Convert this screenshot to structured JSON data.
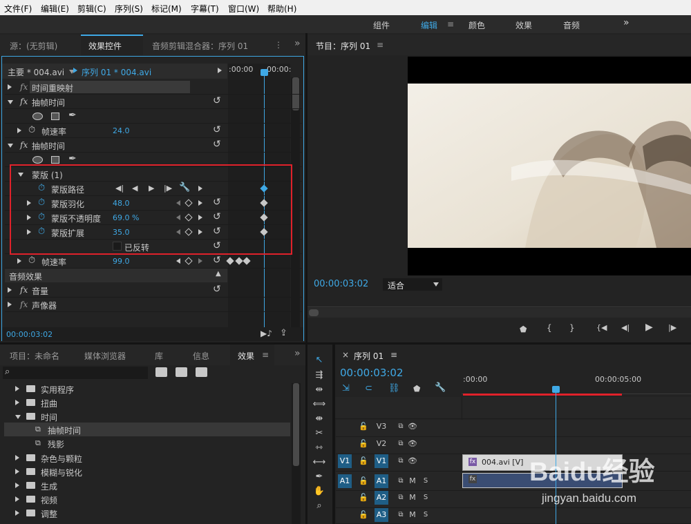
{
  "menu": [
    "文件(F)",
    "编辑(E)",
    "剪辑(C)",
    "序列(S)",
    "标记(M)",
    "字幕(T)",
    "窗口(W)",
    "帮助(H)"
  ],
  "workspace": {
    "tabs": [
      "组件",
      "编辑",
      "颜色",
      "效果",
      "音频"
    ],
    "active": "编辑",
    "more": "»"
  },
  "effect_controls": {
    "tabs": [
      "源：(无剪辑)",
      "效果控件",
      "音频剪辑混合器：序列 01"
    ],
    "more": "»",
    "master": "主要 * 004.avi",
    "seq": "序列 01 * 004.avi",
    "time_a": ":00:00",
    "time_b": "00:00:",
    "rows": {
      "time_remap": "时间重映射",
      "posterize1": "抽帧时间",
      "framerate1_label": "帧速率",
      "framerate1_value": "24.0",
      "posterize2": "抽帧时间",
      "mask": "蒙版 (1)",
      "mask_path": "蒙版路径",
      "feather_label": "蒙版羽化",
      "feather_value": "48.0",
      "opacity_label": "蒙版不透明度",
      "opacity_value": "69.0 %",
      "expand_label": "蒙版扩展",
      "expand_value": "35.0",
      "inverted": "已反转",
      "framerate2_label": "帧速率",
      "framerate2_value": "99.0",
      "audio_effects": "音频效果",
      "volume": "音量",
      "panner": "声像器"
    },
    "timecode": "00:00:03:02"
  },
  "program": {
    "title": "节目：序列 01",
    "timecode": "00:00:03:02",
    "fit": "适合"
  },
  "project": {
    "tabs": [
      "项目：未命名",
      "媒体浏览器",
      "库",
      "信息",
      "效果"
    ],
    "more": "»",
    "tree": [
      "实用程序",
      "扭曲",
      "时间",
      "抽帧时间",
      "残影",
      "杂色与颗粒",
      "模糊与锐化",
      "生成",
      "视频",
      "调整"
    ]
  },
  "timeline": {
    "title": "序列 01",
    "timecode": "00:00:03:02",
    "ruler": [
      ":00:00",
      "00:00:05:00"
    ],
    "tracks": [
      {
        "src": "",
        "name": "V3"
      },
      {
        "src": "",
        "name": "V2"
      },
      {
        "src": "V1",
        "name": "V1"
      },
      {
        "src": "A1",
        "name": "A1",
        "m": "M",
        "s": "S"
      },
      {
        "src": "",
        "name": "A2",
        "m": "M",
        "s": "S"
      },
      {
        "src": "",
        "name": "A3",
        "m": "M",
        "s": "S"
      }
    ],
    "clip": "004.avi [V]",
    "clip_fx": "fx"
  },
  "watermark": {
    "brand": "Baidu经验",
    "url": "jingyan.baidu.com"
  },
  "colors": {
    "accent": "#3fa9e6",
    "red_box": "#e0212a",
    "clip_video": "#d8d8d8",
    "clip_audio": "#3a4d73"
  }
}
